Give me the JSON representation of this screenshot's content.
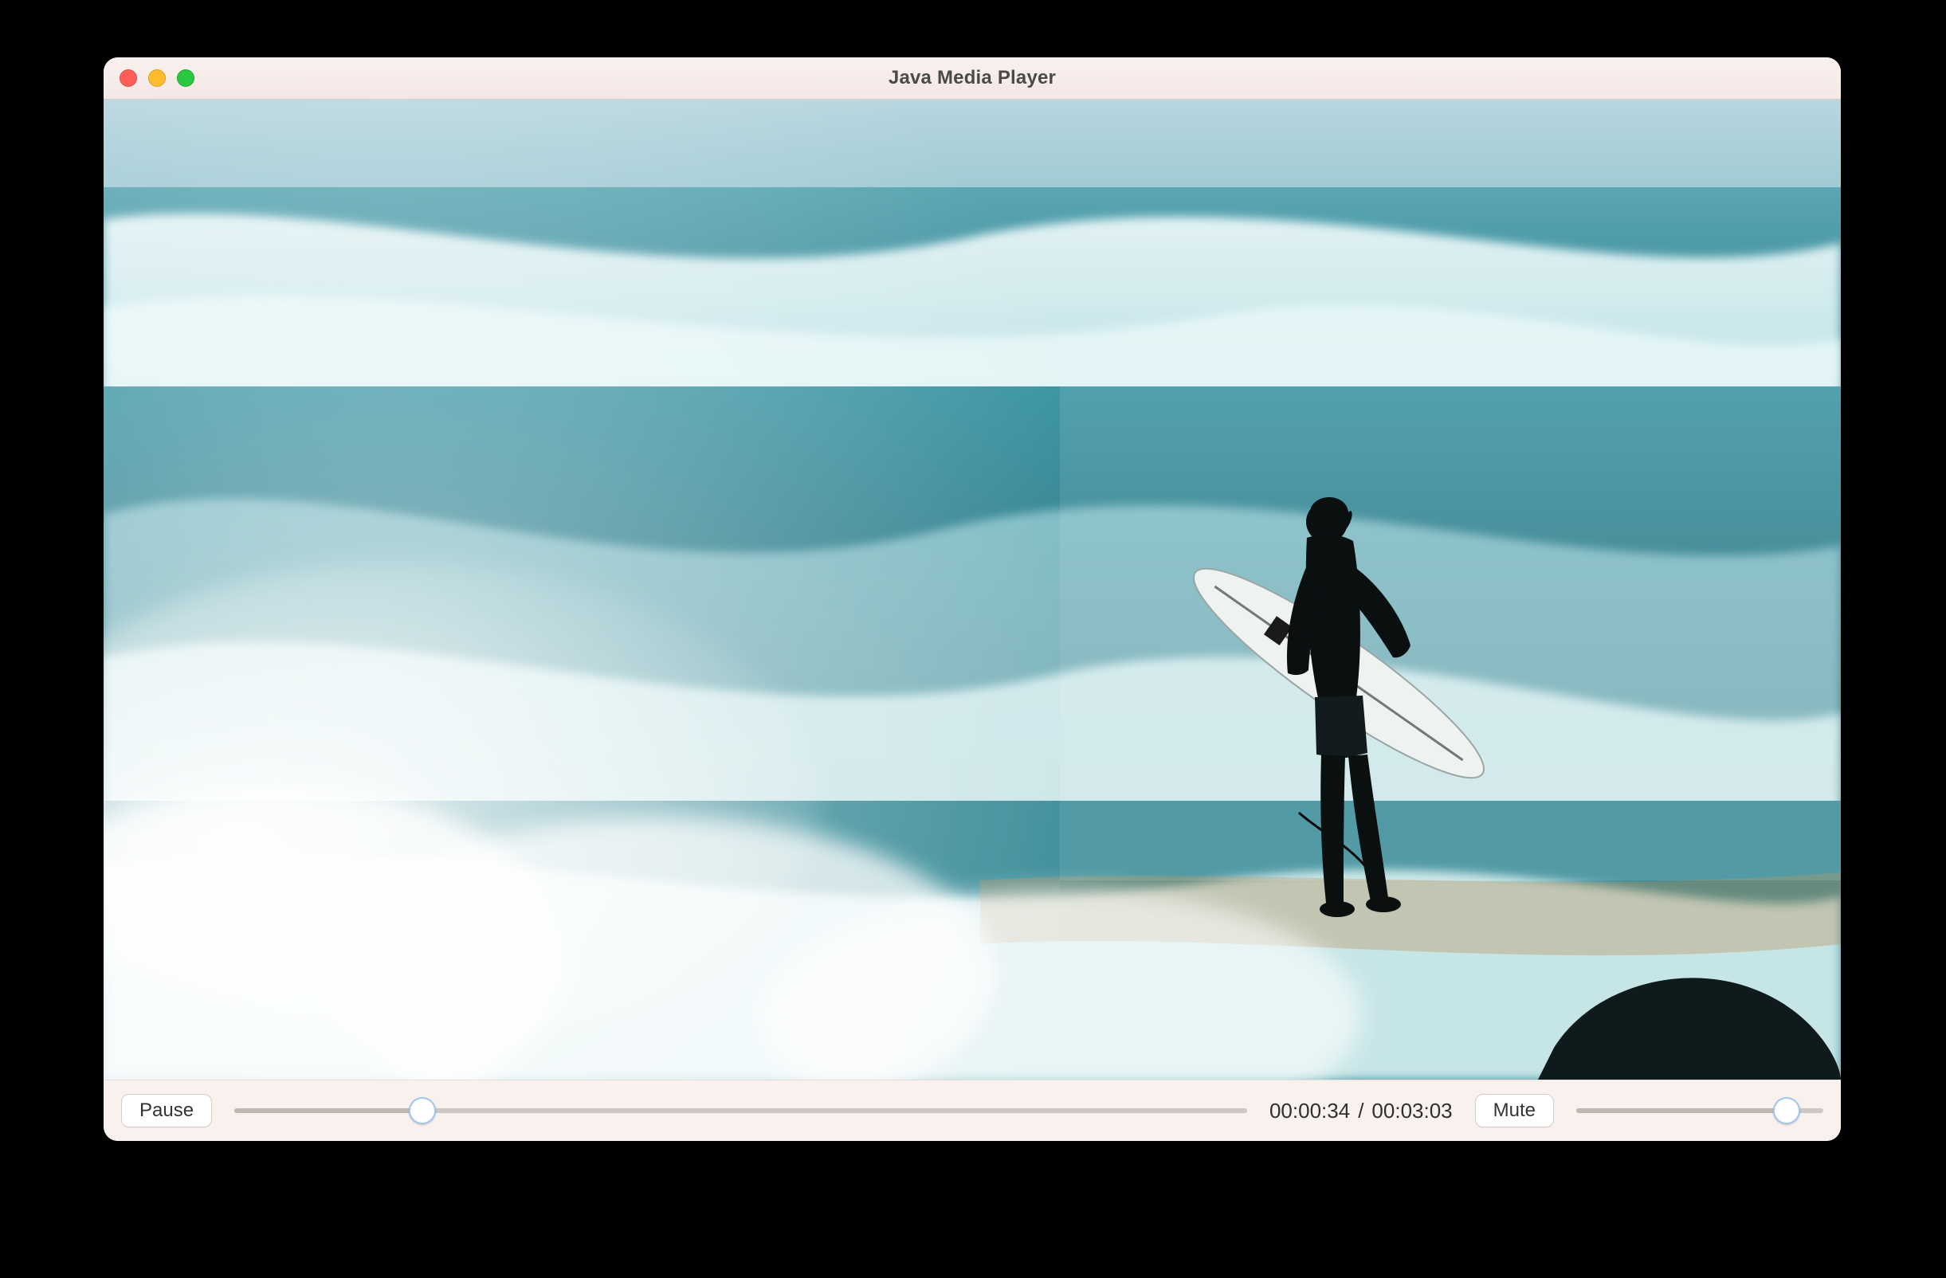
{
  "window": {
    "title": "Java Media Player"
  },
  "controls": {
    "pause_label": "Pause",
    "mute_label": "Mute",
    "current_time": "00:00:34",
    "separator": "/",
    "total_time": "00:03:03",
    "seek_percent": 18.6,
    "volume_percent": 85
  }
}
